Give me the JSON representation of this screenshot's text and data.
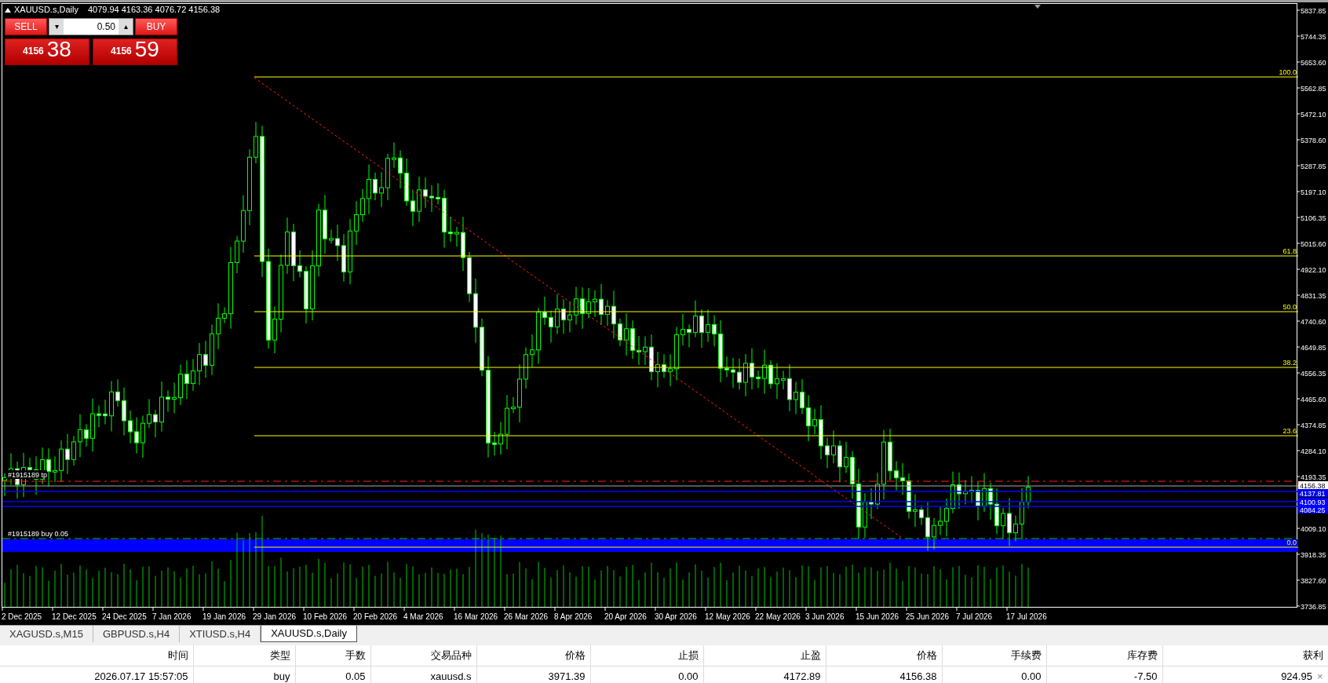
{
  "chart": {
    "symbol": "XAUUSD.s,Daily",
    "ohlc": "4079.94 4163.36 4076.72 4156.38",
    "price_ticks": [
      "5837.85",
      "5744.35",
      "5653.60",
      "5562.85",
      "5472.10",
      "5378.60",
      "5287.85",
      "5197.10",
      "5106.35",
      "5015.60",
      "4922.10",
      "4831.35",
      "4740.60",
      "4649.85",
      "4556.35",
      "4465.60",
      "4374.85",
      "4284.10",
      "4193.35",
      "4009.10",
      "3918.35",
      "3827.60",
      "3736.85"
    ],
    "price_labels": [
      {
        "text": "4156.38",
        "color": "#ffffff"
      },
      {
        "text": "4137.81",
        "color": "#0000ff"
      },
      {
        "text": "4100.93",
        "color": "#0000ff"
      },
      {
        "text": "4084.25",
        "color": "#0000ff"
      }
    ],
    "fib_levels": [
      {
        "label": "100.0"
      },
      {
        "label": "61.8"
      },
      {
        "label": "50.0"
      },
      {
        "label": "38.2"
      },
      {
        "label": "23.6"
      },
      {
        "label": "0.0"
      }
    ],
    "order_labels": [
      "#1915189 tp",
      "#1915189 buy 0.05"
    ],
    "dates": [
      "2 Dec 2025",
      "12 Dec 2025",
      "24 Dec 2025",
      "7 Jan 2026",
      "19 Jan 2026",
      "29 Jan 2026",
      "10 Feb 2026",
      "20 Feb 2026",
      "4 Mar 2026",
      "16 Mar 2026",
      "26 Mar 2026",
      "8 Apr 2026",
      "20 Apr 2026",
      "30 Apr 2026",
      "12 May 2026",
      "22 May 2026",
      "3 Jun 2026",
      "15 Jun 2026",
      "25 Jun 2026",
      "7 Jul 2026",
      "17 Jul 2026"
    ]
  },
  "trade_panel": {
    "sell_label": "SELL",
    "buy_label": "BUY",
    "lot": "0.50",
    "down": "▾",
    "up": "▴",
    "bid": {
      "prefix": "4156",
      "pips": "38"
    },
    "ask": {
      "prefix": "4156",
      "pips": "59"
    }
  },
  "tabs": [
    {
      "label": "XAGUSD.s,M15",
      "selected": false
    },
    {
      "label": "GBPUSD.s,H4",
      "selected": false
    },
    {
      "label": "XTIUSD.s,H4",
      "selected": false
    },
    {
      "label": "XAUUSD.s,Daily",
      "selected": true
    }
  ],
  "table": {
    "columns": [
      "时间",
      "类型",
      "手数",
      "交易品种",
      "价格",
      "止损",
      "止盈",
      "价格",
      "手续费",
      "库存费",
      "获利"
    ],
    "rows": [
      {
        "cells": [
          "2026.07.17 15:57:05",
          "buy",
          "0.05",
          "xauusd.s",
          "3971.39",
          "0.00",
          "4172.89",
          "4156.38",
          "0.00",
          "-7.50",
          "924.95"
        ],
        "close": "×"
      }
    ]
  }
}
